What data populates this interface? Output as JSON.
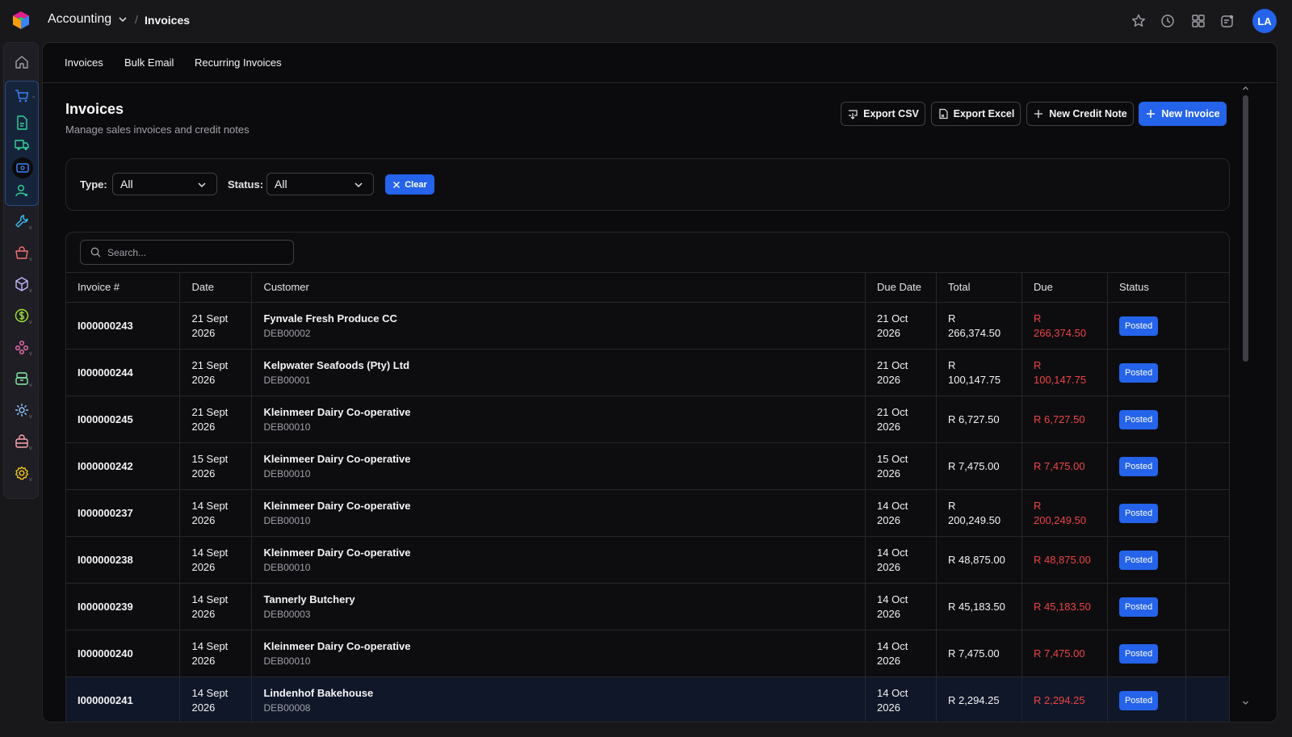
{
  "header": {
    "app_name": "Accounting",
    "breadcrumb_sep": "/",
    "breadcrumb_current": "Invoices",
    "avatar_initials": "LA",
    "accent_color": "#2563eb"
  },
  "icons": {
    "top": [
      "star-icon",
      "history-icon",
      "apps-grid-icon",
      "notifications-icon"
    ],
    "rail": [
      "home-icon",
      "cart-icon",
      "document-icon",
      "truck-icon",
      "payment-icon",
      "user-icon",
      "wrench-icon",
      "shopping-bag-icon",
      "package-icon",
      "dollar-icon",
      "people-icon",
      "storage-icon",
      "gear-network-icon",
      "toolbox-icon",
      "settings-icon"
    ]
  },
  "subnav": {
    "items": [
      "Invoices",
      "Bulk Email",
      "Recurring Invoices"
    ]
  },
  "page": {
    "title": "Invoices",
    "subtitle": "Manage sales invoices and credit notes",
    "actions": {
      "export_csv": "Export CSV",
      "export_excel": "Export Excel",
      "new_credit_note": "New Credit Note",
      "new_invoice": "New Invoice"
    }
  },
  "filters": {
    "type_label": "Type:",
    "type_value": "All",
    "status_label": "Status:",
    "status_value": "All",
    "clear_label": "Clear"
  },
  "table": {
    "search_placeholder": "Search...",
    "columns": [
      "Invoice #",
      "Date",
      "Customer",
      "Due Date",
      "Total",
      "Due",
      "Status",
      ""
    ],
    "rows": [
      {
        "invoice": "I000000243",
        "date": "21 Sept 2026",
        "customer": "Fynvale Fresh Produce CC",
        "code": "DEB00002",
        "due_date": "21 Oct 2026",
        "total": "R 266,374.50",
        "due": "R 266,374.50",
        "status": "Posted"
      },
      {
        "invoice": "I000000244",
        "date": "21 Sept 2026",
        "customer": "Kelpwater Seafoods (Pty) Ltd",
        "code": "DEB00001",
        "due_date": "21 Oct 2026",
        "total": "R 100,147.75",
        "due": "R 100,147.75",
        "status": "Posted"
      },
      {
        "invoice": "I000000245",
        "date": "21 Sept 2026",
        "customer": "Kleinmeer Dairy Co-operative",
        "code": "DEB00010",
        "due_date": "21 Oct 2026",
        "total": "R 6,727.50",
        "due": "R 6,727.50",
        "status": "Posted"
      },
      {
        "invoice": "I000000242",
        "date": "15 Sept 2026",
        "customer": "Kleinmeer Dairy Co-operative",
        "code": "DEB00010",
        "due_date": "15 Oct 2026",
        "total": "R 7,475.00",
        "due": "R 7,475.00",
        "status": "Posted"
      },
      {
        "invoice": "I000000237",
        "date": "14 Sept 2026",
        "customer": "Kleinmeer Dairy Co-operative",
        "code": "DEB00010",
        "due_date": "14 Oct 2026",
        "total": "R 200,249.50",
        "due": "R 200,249.50",
        "status": "Posted"
      },
      {
        "invoice": "I000000238",
        "date": "14 Sept 2026",
        "customer": "Kleinmeer Dairy Co-operative",
        "code": "DEB00010",
        "due_date": "14 Oct 2026",
        "total": "R 48,875.00",
        "due": "R 48,875.00",
        "status": "Posted"
      },
      {
        "invoice": "I000000239",
        "date": "14 Sept 2026",
        "customer": "Tannerly Butchery",
        "code": "DEB00003",
        "due_date": "14 Oct 2026",
        "total": "R 45,183.50",
        "due": "R 45,183.50",
        "status": "Posted"
      },
      {
        "invoice": "I000000240",
        "date": "14 Sept 2026",
        "customer": "Kleinmeer Dairy Co-operative",
        "code": "DEB00010",
        "due_date": "14 Oct 2026",
        "total": "R 7,475.00",
        "due": "R 7,475.00",
        "status": "Posted"
      },
      {
        "invoice": "I000000241",
        "date": "14 Sept 2026",
        "customer": "Lindenhof Bakehouse",
        "code": "DEB00008",
        "due_date": "14 Oct 2026",
        "total": "R 2,294.25",
        "due": "R 2,294.25",
        "status": "Posted"
      }
    ]
  }
}
